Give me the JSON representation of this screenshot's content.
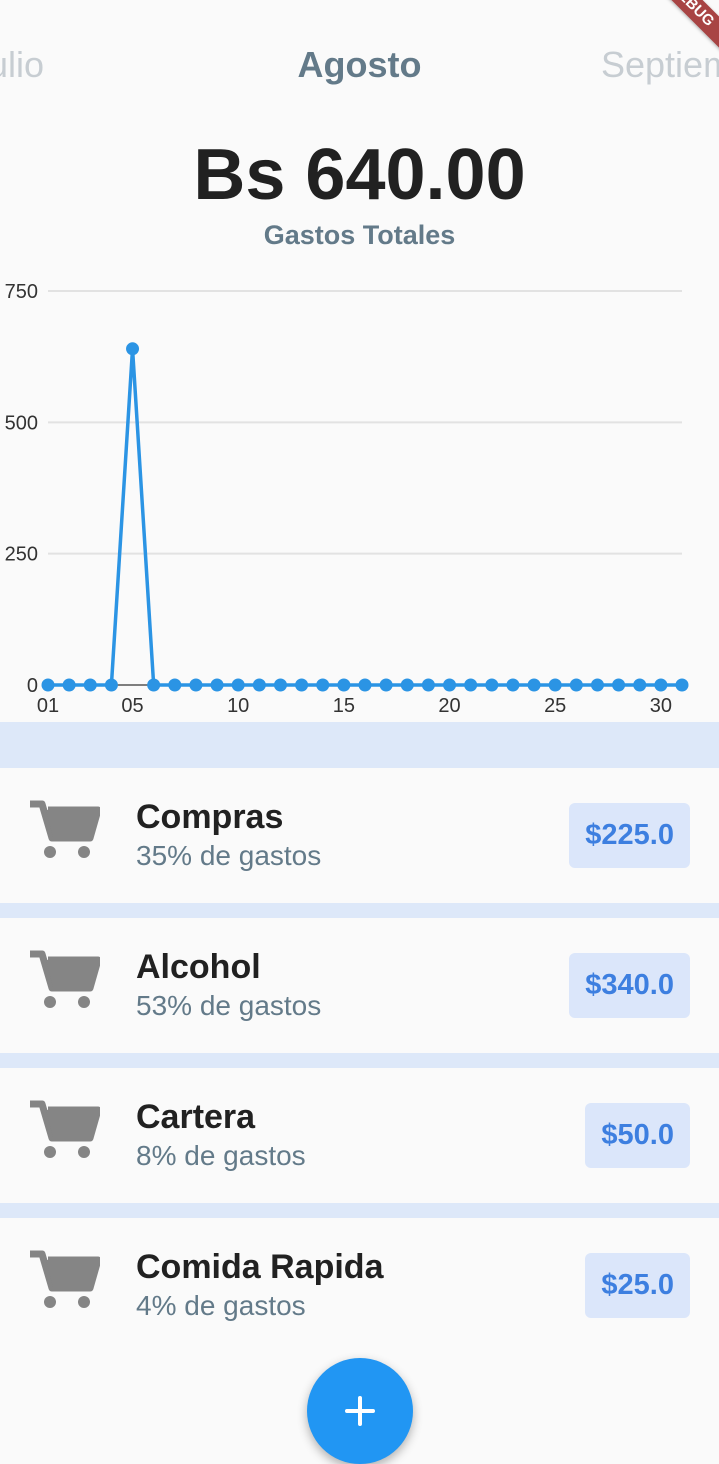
{
  "debug_banner": "DEBUG",
  "months": {
    "previous": "Julio",
    "current": "Agosto",
    "next": "Septiembre"
  },
  "summary": {
    "total": "Bs 640.00",
    "label": "Gastos Totales"
  },
  "chart_data": {
    "type": "line",
    "y_ticks": [
      "750",
      "500",
      "250",
      "0"
    ],
    "ylim": [
      0,
      750
    ],
    "x_ticks": [
      "01",
      "05",
      "10",
      "15",
      "20",
      "25",
      "30"
    ],
    "x_range": [
      1,
      31
    ],
    "grid": true,
    "series": [
      {
        "color": "#2b94e4",
        "x": [
          1,
          2,
          3,
          4,
          5,
          6,
          7,
          8,
          9,
          10,
          11,
          12,
          13,
          14,
          15,
          16,
          17,
          18,
          19,
          20,
          21,
          22,
          23,
          24,
          25,
          26,
          27,
          28,
          29,
          30,
          31
        ],
        "values": [
          0,
          0,
          0,
          0,
          640,
          0,
          0,
          0,
          0,
          0,
          0,
          0,
          0,
          0,
          0,
          0,
          0,
          0,
          0,
          0,
          0,
          0,
          0,
          0,
          0,
          0,
          0,
          0,
          0,
          0,
          0
        ]
      }
    ]
  },
  "categories": [
    {
      "icon": "shopping-cart-icon",
      "title": "Compras",
      "subtitle": "35% de gastos",
      "amount": "$225.0"
    },
    {
      "icon": "shopping-cart-icon",
      "title": "Alcohol",
      "subtitle": "53% de gastos",
      "amount": "$340.0"
    },
    {
      "icon": "shopping-cart-icon",
      "title": "Cartera",
      "subtitle": "8% de gastos",
      "amount": "$50.0"
    },
    {
      "icon": "shopping-cart-icon",
      "title": "Comida Rapida",
      "subtitle": "4% de gastos",
      "amount": "$25.0"
    }
  ],
  "fab": {
    "icon": "plus-icon"
  },
  "colors": {
    "accent": "#2196f3",
    "band": "#dde8f9",
    "badge_bg": "#dbe6fa",
    "badge_text": "#3d7fe0",
    "muted": "#637a89"
  }
}
